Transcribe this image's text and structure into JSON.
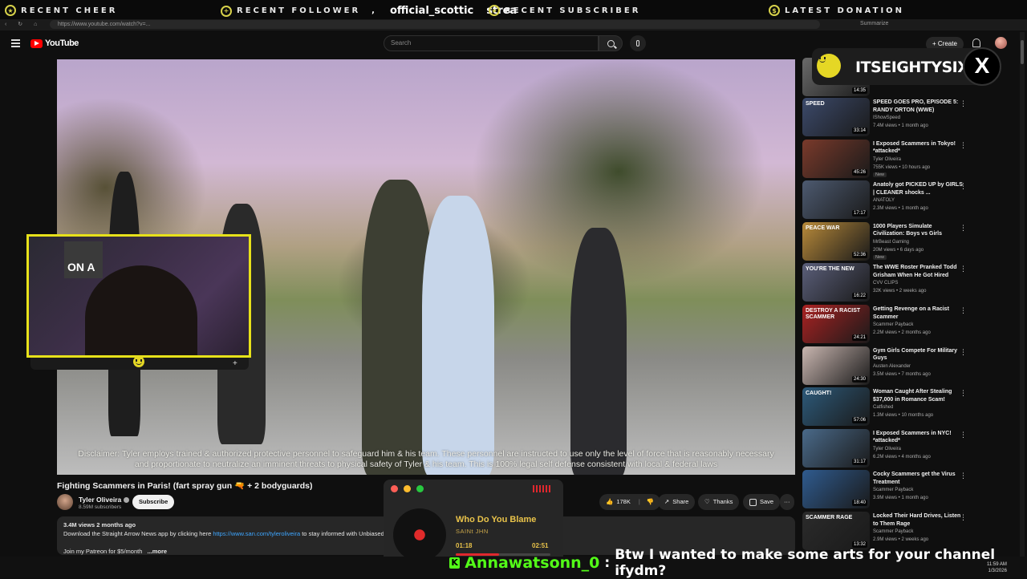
{
  "stream_bar": {
    "recent_cheer": "RECENT CHEER",
    "recent_follower": "RECENT FOLLOWER",
    "follower_name": "official_scottic",
    "follower_next": "strea",
    "recent_subscriber": "RECENT SUBSCRIBER",
    "latest_donation": "LATEST DONATION"
  },
  "browser": {
    "url": "https://www.youtube.com/watch?v=...",
    "summarize": "Summarize"
  },
  "header": {
    "logo": "YouTube",
    "search_placeholder": "Search",
    "create_label": "+ Create"
  },
  "video": {
    "disclaimer": "Disclaimer: Tyler employs trained & authorized protective personnel to safeguard him & his team. These personnel are instructed to use only the level of force that is reasonably necessary and proportionate to neutralize an imminent threats to physical safety of Tyler & his team. This is 100% legal self defense consistent with local & federal laws",
    "title": "Fighting Scammers in Paris! (fart spray gun 🔫 + 2 bodyguards)",
    "channel": "Tyler Oliveira",
    "subscribers": "8.59M subscribers",
    "subscribe_label": "Subscribe",
    "likes": "178K",
    "share_label": "Share",
    "thanks_label": "Thanks",
    "save_label": "Save",
    "more_label": "···",
    "views_date": "3.4M views  2 months ago",
    "desc_line1": "Download the Straight Arrow News app by clicking here ",
    "desc_link": "https://www.san.com/tyleroliveira",
    "desc_line1_end": " to stay informed with Unbiased. Straight",
    "desc_line2": "Join my Patreon for $5/month",
    "desc_more": "...more"
  },
  "webcam": {
    "sign_text": "ON A"
  },
  "brand": {
    "name": "ITSEIGHTYSIX",
    "x_label": "X"
  },
  "sidebar": {
    "items": [
      {
        "title": "",
        "channel": "",
        "meta": "",
        "duration": "14:35",
        "badge": ""
      },
      {
        "title": "SPEED GOES PRO, EPISODE 5: RANDY ORTON (WWE)",
        "channel": "IShowSpeed",
        "meta": "7.4M views • 1 month ago",
        "duration": "33:14",
        "badge": ""
      },
      {
        "title": "I Exposed Scammers in Tokyo! *attacked*",
        "channel": "Tyler Oliveira",
        "meta": "755K views • 10 hours ago",
        "duration": "45:26",
        "badge": "New"
      },
      {
        "title": "Anatoly got PICKED UP by GIRLS | CLEANER shocks ...",
        "channel": "ANATOLY",
        "meta": "2.3M views • 1 month ago",
        "duration": "17:17",
        "badge": ""
      },
      {
        "title": "1000 Players Simulate Civilization: Boys vs Girls",
        "channel": "MrBeast Gaming",
        "meta": "20M views • 6 days ago",
        "duration": "52:36",
        "badge": "New"
      },
      {
        "title": "The WWE Roster Pranked Todd Grisham When He Got Hired",
        "channel": "CVV CLIPS",
        "meta": "32K views • 2 weeks ago",
        "duration": "16:22",
        "badge": ""
      },
      {
        "title": "Getting Revenge on a Racist Scammer",
        "channel": "Scammer Payback",
        "meta": "2.2M views • 2 months ago",
        "duration": "24:21",
        "badge": ""
      },
      {
        "title": "Gym Girls Compete For Military Guys",
        "channel": "Austen Alexander",
        "meta": "3.5M views • 7 months ago",
        "duration": "24:30",
        "badge": ""
      },
      {
        "title": "Woman Caught After Stealing $37,000 in Romance Scam!",
        "channel": "Catfished",
        "meta": "1.3M views • 10 months ago",
        "duration": "57:06",
        "badge": ""
      },
      {
        "title": "I Exposed Scammers in NYC! *attacked*",
        "channel": "Tyler Oliveira",
        "meta": "6.2M views • 4 months ago",
        "duration": "31:17",
        "badge": ""
      },
      {
        "title": "Cocky Scammers get the Virus Treatment",
        "channel": "Scammer Payback",
        "meta": "3.9M views • 1 month ago",
        "duration": "18:40",
        "badge": ""
      },
      {
        "title": "Locked Their Hard Drives, Listen to Them Rage",
        "channel": "Scammer Payback",
        "meta": "2.9M views • 2 weeks ago",
        "duration": "13:32",
        "badge": ""
      }
    ],
    "thumb_texts": [
      "",
      "SPEED",
      "",
      "",
      "PEACE  WAR",
      "YOU'RE THE NEW",
      "DESTROY A RACIST SCAMMER",
      "",
      "CAUGHT!",
      "",
      "",
      "SCAMMER RAGE"
    ]
  },
  "player": {
    "song": "Who Do You Blame",
    "artist": "SAINt JHN",
    "current": "01:18",
    "total": "02:51",
    "progress": 0.46
  },
  "chat": {
    "platform_icon": "K",
    "user": "Annawatsonn_0",
    "separator": ":",
    "message": "Btw I wanted to make some arts for your channel ifydm?"
  },
  "taskbar": {
    "time": "11:59 AM",
    "date": "1/3/2026"
  },
  "colors": {
    "accent_yellow": "#e7e11a",
    "youtube_red": "#ff0000",
    "kick_green": "#53fc18",
    "player_gold": "#e9c34a"
  }
}
